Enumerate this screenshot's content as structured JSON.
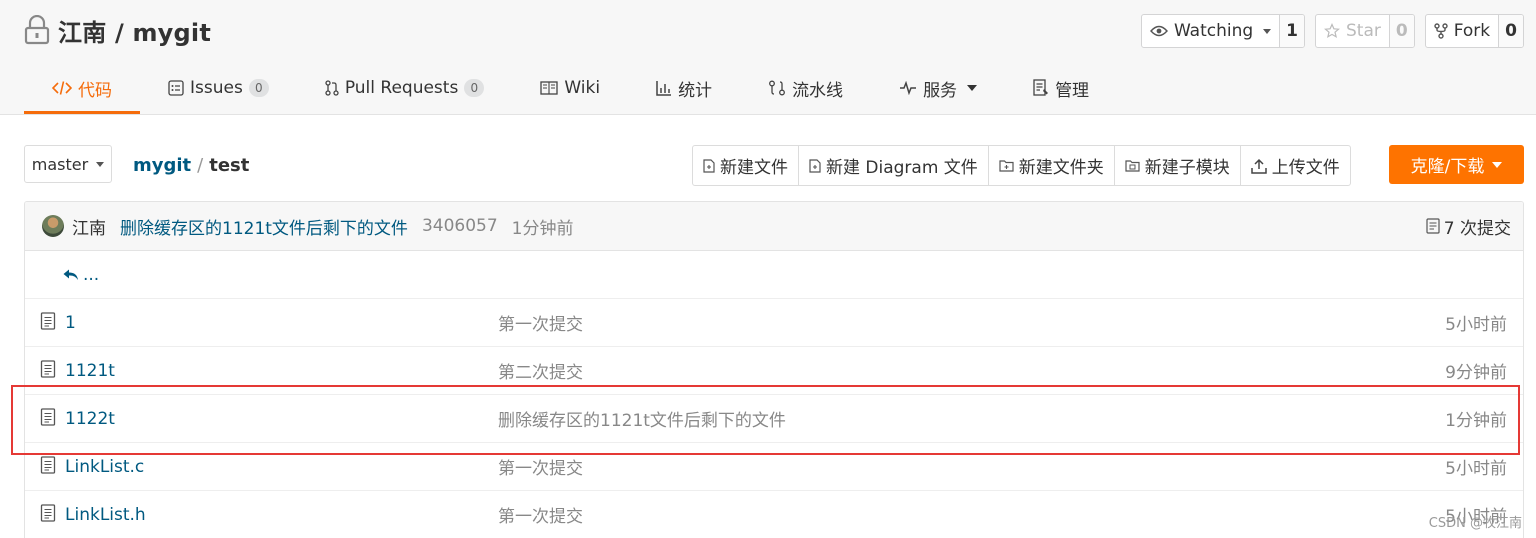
{
  "header": {
    "repo_title": "江南 / mygit",
    "watch": {
      "label": "Watching",
      "count": "1"
    },
    "star": {
      "label": "Star",
      "count": "0"
    },
    "fork": {
      "label": "Fork",
      "count": "0"
    }
  },
  "nav": {
    "tabs": [
      {
        "label": "代码",
        "icon": "code-icon",
        "active": true
      },
      {
        "label": "Issues",
        "badge": "0",
        "icon": "issues-icon"
      },
      {
        "label": "Pull Requests",
        "badge": "0",
        "icon": "pull-request-icon"
      },
      {
        "label": "Wiki",
        "icon": "wiki-icon"
      },
      {
        "label": "统计",
        "icon": "stats-icon"
      },
      {
        "label": "流水线",
        "icon": "pipeline-icon"
      },
      {
        "label": "服务",
        "icon": "service-icon"
      },
      {
        "label": "管理",
        "icon": "manage-icon"
      }
    ]
  },
  "toolbar": {
    "branch": "master",
    "breadcrumb": {
      "repo": "mygit",
      "separator": "/",
      "current": "test"
    },
    "buttons": [
      {
        "label": "新建文件",
        "icon": "new-file-icon"
      },
      {
        "label": "新建 Diagram 文件",
        "icon": "new-diagram-icon"
      },
      {
        "label": "新建文件夹",
        "icon": "new-folder-icon"
      },
      {
        "label": "新建子模块",
        "icon": "new-submodule-icon"
      },
      {
        "label": "上传文件",
        "icon": "upload-icon"
      }
    ],
    "clone_label": "克隆/下载"
  },
  "commit": {
    "author": "江南",
    "message": "删除缓存区的1121t文件后剩下的文件",
    "sha": "3406057",
    "time": "1分钟前",
    "count_label": "7 次提交"
  },
  "back_label": "...",
  "files": [
    {
      "name": "1",
      "message": "第一次提交",
      "time": "5小时前"
    },
    {
      "name": "1121t",
      "message": "第二次提交",
      "time": "9分钟前"
    },
    {
      "name": "1122t",
      "message": "删除缓存区的1121t文件后剩下的文件",
      "time": "1分钟前"
    },
    {
      "name": "LinkList.c",
      "message": "第一次提交",
      "time": "5小时前"
    },
    {
      "name": "LinkList.h",
      "message": "第一次提交",
      "time": "5小时前"
    }
  ],
  "colors": {
    "accent": "#f56c0b",
    "clone_button": "#fe7300",
    "link": "#005980",
    "highlight_box": "#e53935"
  },
  "watermark": "CSDN @牧江南"
}
